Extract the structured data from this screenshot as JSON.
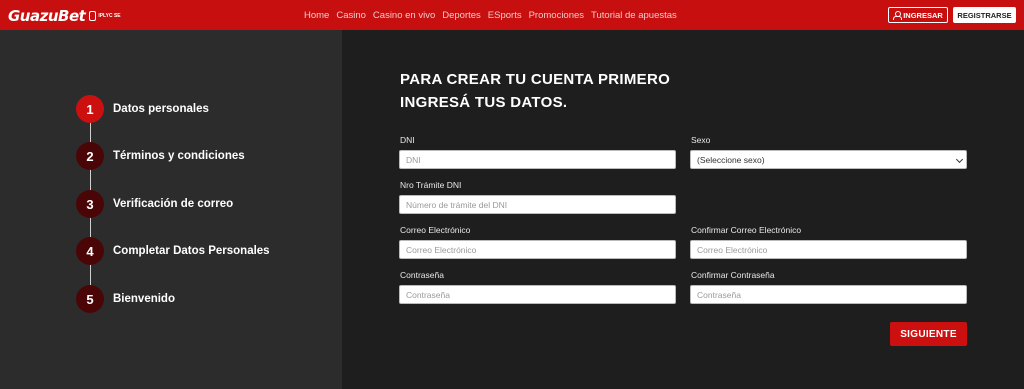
{
  "header": {
    "logo_text": "GuazuBet",
    "logo_badge_text": "IPLYC SE",
    "nav": [
      "Home",
      "Casino",
      "Casino en vivo",
      "Deportes",
      "ESports",
      "Promociones",
      "Tutorial de apuestas"
    ],
    "login_label": "INGRESAR",
    "register_label": "REGISTRARSE"
  },
  "steps": [
    {
      "num": "1",
      "label": "Datos personales",
      "active": true
    },
    {
      "num": "2",
      "label": "Términos y condiciones",
      "active": false
    },
    {
      "num": "3",
      "label": "Verificación de correo",
      "active": false
    },
    {
      "num": "4",
      "label": "Completar Datos Personales",
      "active": false
    },
    {
      "num": "5",
      "label": "Bienvenido",
      "active": false
    }
  ],
  "form": {
    "title_line1": "PARA CREAR TU CUENTA PRIMERO",
    "title_line2": "INGRESÁ TUS DATOS.",
    "dni": {
      "label": "DNI",
      "placeholder": "DNI"
    },
    "sexo": {
      "label": "Sexo",
      "selected": "(Seleccione sexo)"
    },
    "tramite": {
      "label": "Nro Trámite DNI",
      "placeholder": "Número de trámite del DNI"
    },
    "email": {
      "label": "Correo Electrónico",
      "placeholder": "Correo Electrónico"
    },
    "email_confirm": {
      "label": "Confirmar Correo Electrónico",
      "placeholder": "Correo Electrónico"
    },
    "password": {
      "label": "Contraseña",
      "placeholder": "Contraseña"
    },
    "password_confirm": {
      "label": "Confirmar Contraseña",
      "placeholder": "Contraseña"
    },
    "next_label": "SIGUIENTE"
  },
  "colors": {
    "brand_red": "#c70f0f",
    "button_red": "#cc1010",
    "step_inactive": "#4a0606",
    "left_panel": "#2c2c2c",
    "right_panel": "#1e1e1e"
  }
}
